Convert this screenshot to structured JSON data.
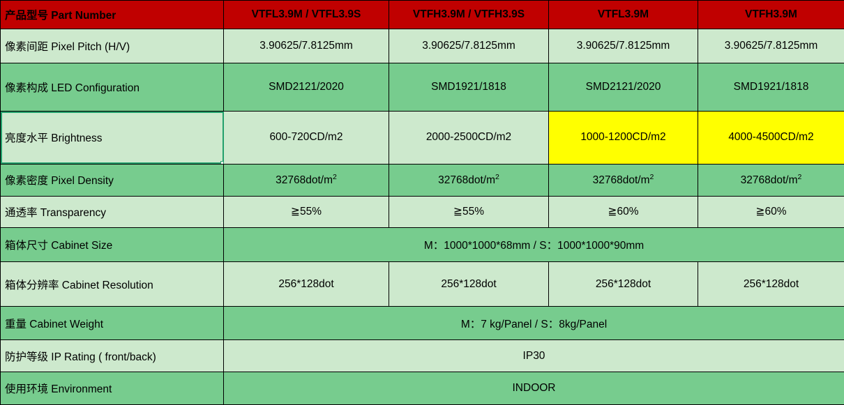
{
  "table": {
    "header": {
      "label": "产品型号 Part Number",
      "columns": [
        "VTFL3.9M / VTFL3.9S",
        "VTFH3.9M / VTFH3.9S",
        "VTFL3.9M",
        "VTFH3.9M"
      ]
    },
    "rows": [
      {
        "label": "像素间距 Pixel Pitch (H/V)",
        "fill": "light",
        "values": [
          "3.90625/7.8125mm",
          "3.90625/7.8125mm",
          "3.90625/7.8125mm",
          "3.90625/7.8125mm"
        ]
      },
      {
        "label": "像素构成 LED Configuration",
        "fill": "dark",
        "values": [
          "SMD2121/2020",
          "SMD1921/1818",
          "SMD2121/2020",
          "SMD1921/1818"
        ]
      },
      {
        "label": "亮度水平 Brightness",
        "fill": "light",
        "values": [
          "600-720CD/m2",
          "2000-2500CD/m2",
          "1000-1200CD/m2",
          "4000-4500CD/m2"
        ]
      },
      {
        "label": "像素密度 Pixel Density",
        "fill": "dark",
        "values": [
          "32768dot/m2",
          "32768dot/m2",
          "32768dot/m2",
          "32768dot/m2"
        ]
      },
      {
        "label": "通透率 Transparency",
        "fill": "light",
        "values": [
          "≧55%",
          "≧55%",
          "≧60%",
          "≧60%"
        ]
      },
      {
        "label": "箱体尺寸 Cabinet Size",
        "fill": "dark",
        "merged_value": "M：1000*1000*68mm  /  S：1000*1000*90mm"
      },
      {
        "label": "箱体分辨率 Cabinet Resolution",
        "fill": "light",
        "values": [
          "256*128dot",
          "256*128dot",
          "256*128dot",
          "256*128dot"
        ]
      },
      {
        "label": "重量  Cabinet Weight",
        "fill": "dark",
        "merged_value": "M：7 kg/Panel  /  S：8kg/Panel"
      },
      {
        "label": "防护等级 IP Rating ( front/back)",
        "fill": "light",
        "merged_value": "IP30"
      },
      {
        "label": "使用环境 Environment",
        "fill": "dark",
        "merged_value": "INDOOR"
      }
    ]
  },
  "colors": {
    "header_red": "#C00000",
    "fill_light_green": "#CDE9CD",
    "fill_dark_green": "#77CC8E",
    "highlight_yellow": "#FFFF00",
    "emphasis_red_text": "#FF0000",
    "selection_outline": "#22A06B"
  }
}
